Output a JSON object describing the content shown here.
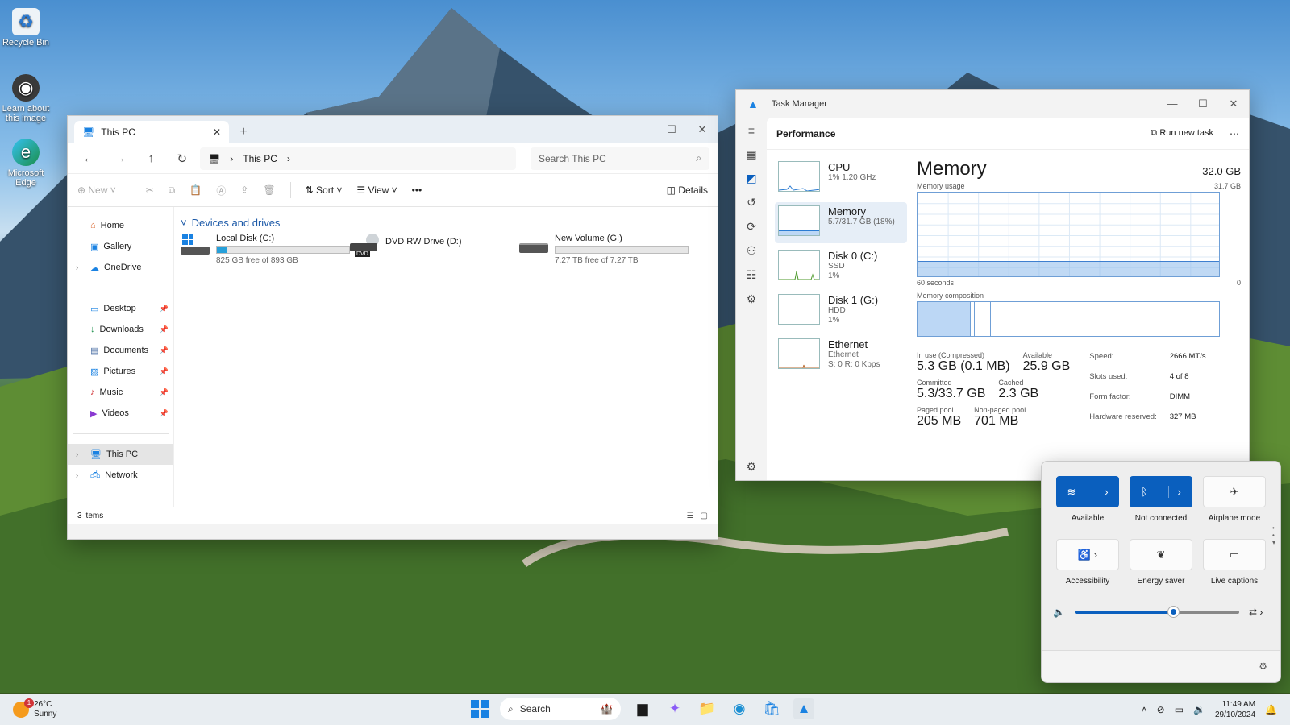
{
  "desktop": {
    "icons": [
      {
        "label": "Recycle Bin",
        "icon": "recycle-bin-icon"
      },
      {
        "label": "Learn about this image",
        "icon": "camera-icon"
      },
      {
        "label": "Microsoft Edge",
        "icon": "edge-icon"
      }
    ]
  },
  "explorer": {
    "tab_title": "This PC",
    "breadcrumb": "This PC",
    "search_placeholder": "Search This PC",
    "toolbar": {
      "new": "New",
      "sort": "Sort",
      "view": "View",
      "more": "•••",
      "details": "Details"
    },
    "nav": {
      "top": [
        {
          "label": "Home",
          "icon": "home-icon"
        },
        {
          "label": "Gallery",
          "icon": "gallery-icon"
        },
        {
          "label": "OneDrive",
          "icon": "cloud-icon"
        }
      ],
      "pinned": [
        {
          "label": "Desktop",
          "icon": "desktop-icon"
        },
        {
          "label": "Downloads",
          "icon": "download-icon"
        },
        {
          "label": "Documents",
          "icon": "document-icon"
        },
        {
          "label": "Pictures",
          "icon": "pictures-icon"
        },
        {
          "label": "Music",
          "icon": "music-icon"
        },
        {
          "label": "Videos",
          "icon": "video-icon"
        }
      ],
      "bottom": [
        {
          "label": "This PC",
          "icon": "pc-icon",
          "selected": true
        },
        {
          "label": "Network",
          "icon": "network-icon"
        }
      ]
    },
    "group_header": "Devices and drives",
    "drives": [
      {
        "name": "Local Disk (C:)",
        "free": "825 GB free of 893 GB",
        "used_fraction": 0.076,
        "icon": "windows-drive-icon"
      },
      {
        "name": "DVD RW Drive (D:)",
        "free": "",
        "icon": "dvd-drive-icon",
        "dvd_label": "DVD"
      },
      {
        "name": "New Volume (G:)",
        "free": "7.27 TB free of 7.27 TB",
        "used_fraction": 0.0,
        "icon": "hdd-icon"
      }
    ],
    "status": "3 items"
  },
  "taskmgr": {
    "title": "Task Manager",
    "page": "Performance",
    "run_new_task": "Run new task",
    "list": [
      {
        "name": "CPU",
        "sub1": "1% 1.20 GHz",
        "sub2": "",
        "sub3": ""
      },
      {
        "name": "Memory",
        "sub1": "5.7/31.7 GB (18%)",
        "sub2": "",
        "sub3": "",
        "selected": true
      },
      {
        "name": "Disk 0 (C:)",
        "sub1": "SSD",
        "sub2": "1%",
        "sub3": ""
      },
      {
        "name": "Disk 1 (G:)",
        "sub1": "HDD",
        "sub2": "1%",
        "sub3": ""
      },
      {
        "name": "Ethernet",
        "sub1": "Ethernet",
        "sub2": "S: 0 R: 0 Kbps",
        "sub3": ""
      }
    ],
    "memory": {
      "title": "Memory",
      "capacity": "32.0 GB",
      "usage_label": "Memory usage",
      "usage_max": "31.7 GB",
      "seconds": "60 seconds",
      "zero": "0",
      "usage_fraction": 0.18,
      "composition_label": "Memory composition",
      "in_use_label": "In use (Compressed)",
      "in_use": "5.3 GB (0.1 MB)",
      "available_label": "Available",
      "available": "25.9 GB",
      "committed_label": "Committed",
      "committed": "5.3/33.7 GB",
      "cached_label": "Cached",
      "cached": "2.3 GB",
      "paged_label": "Paged pool",
      "paged": "205 MB",
      "nonpaged_label": "Non-paged pool",
      "nonpaged": "701 MB",
      "specs": [
        {
          "k": "Speed:",
          "v": "2666 MT/s"
        },
        {
          "k": "Slots used:",
          "v": "4 of 8"
        },
        {
          "k": "Form factor:",
          "v": "DIMM"
        },
        {
          "k": "Hardware reserved:",
          "v": "327 MB"
        }
      ]
    }
  },
  "quick_settings": {
    "tiles": [
      {
        "label": "Available",
        "icon": "wifi-icon",
        "on": true,
        "split": true
      },
      {
        "label": "Not connected",
        "icon": "bluetooth-icon",
        "on": true,
        "split": true
      },
      {
        "label": "Airplane mode",
        "icon": "airplane-icon",
        "on": false
      },
      {
        "label": "Accessibility",
        "icon": "accessibility-icon",
        "on": false
      },
      {
        "label": "Energy saver",
        "icon": "energy-saver-icon",
        "on": false
      },
      {
        "label": "Live captions",
        "icon": "captions-icon",
        "on": false
      }
    ],
    "volume_fraction": 0.6
  },
  "taskbar": {
    "temp": "26°C",
    "condition": "Sunny",
    "weather_badge": "1",
    "search": "Search",
    "time": "11:49 AM",
    "date": "29/10/2024"
  }
}
